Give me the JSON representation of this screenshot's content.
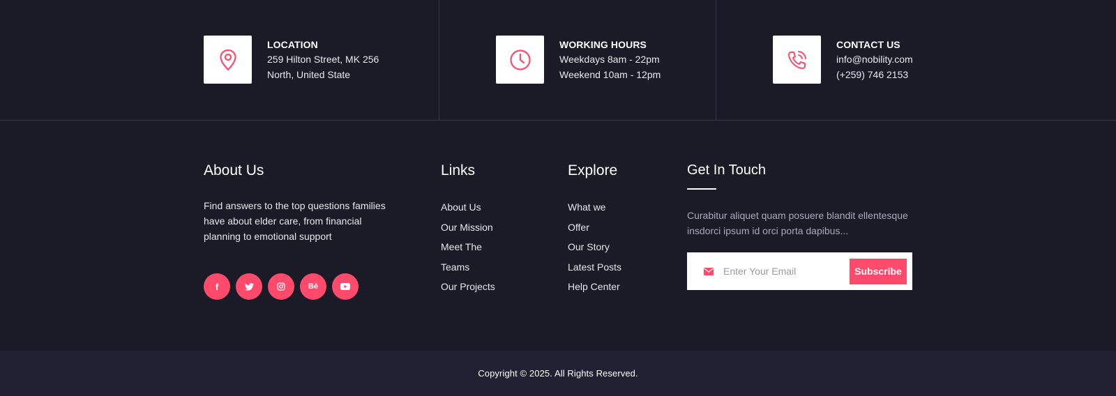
{
  "info": {
    "location": {
      "title": "LOCATION",
      "line1": "259 Hilton Street, MK 256",
      "line2": "North, United State"
    },
    "hours": {
      "title": "WORKING HOURS",
      "line1": "Weekdays 8am - 22pm",
      "line2": "Weekend 10am - 12pm"
    },
    "contact": {
      "title": "CONTACT US",
      "line1": "info@nobility.com",
      "line2": "(+259) 746 2153"
    }
  },
  "about": {
    "heading": "About Us",
    "text": "Find answers to the top questions families have about elder care, from financial planning to emotional support",
    "social": [
      {
        "icon": "facebook-icon",
        "glyph": "f"
      },
      {
        "icon": "twitter-icon",
        "glyph": ""
      },
      {
        "icon": "instagram-icon",
        "glyph": ""
      },
      {
        "icon": "behance-icon",
        "glyph": "Bē"
      },
      {
        "icon": "youtube-icon",
        "glyph": ""
      }
    ]
  },
  "links": {
    "heading": "Links",
    "items": [
      "About Us",
      "Our Mission",
      "Meet The",
      "Teams",
      "Our Projects"
    ]
  },
  "explore": {
    "heading": "Explore",
    "items": [
      "What we",
      "Offer",
      "Our Story",
      "Latest Posts",
      "Help Center"
    ]
  },
  "touch": {
    "heading": "Get In Touch",
    "text": "Curabitur aliquet quam posuere blandit ellentesque insdorci ipsum id orci porta dapibus...",
    "placeholder": "Enter Your Email",
    "button": "Subscribe"
  },
  "footer": {
    "copyright": "Copyright © 2025. All Rights Reserved."
  },
  "colors": {
    "accent": "#ff4a6b",
    "background": "#1b1b28",
    "bottom_bar": "#212133"
  }
}
